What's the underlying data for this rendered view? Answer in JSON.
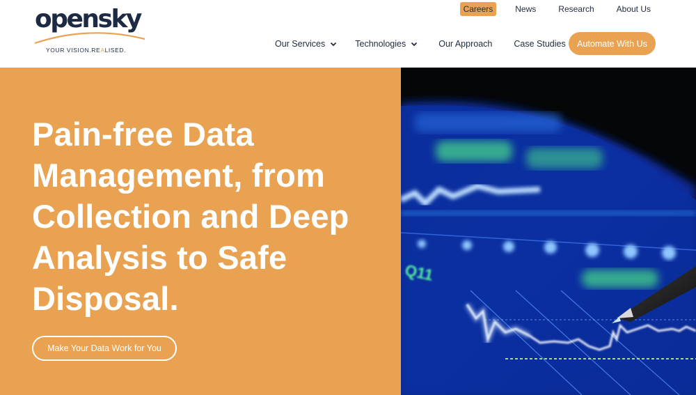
{
  "brand": {
    "name": "opensky",
    "tagline_prefix": "YOUR VISION.RE",
    "tagline_accent": "A",
    "tagline_suffix": "LISED.",
    "colors": {
      "primary_navy": "#1d2a44",
      "accent_orange": "#e8a251"
    }
  },
  "top_nav": [
    {
      "label": "Careers",
      "active": true
    },
    {
      "label": "News",
      "active": false
    },
    {
      "label": "Research",
      "active": false
    },
    {
      "label": "About Us",
      "active": false
    }
  ],
  "main_nav": [
    {
      "label": "Our Services",
      "has_dropdown": true,
      "icon": "chevron-down-icon"
    },
    {
      "label": "Technologies",
      "has_dropdown": true,
      "icon": "chevron-down-icon"
    },
    {
      "label": "Our Approach",
      "has_dropdown": false
    },
    {
      "label": "Case Studies",
      "has_dropdown": false
    }
  ],
  "cta_label": "Automate With Us",
  "hero": {
    "title": "Pain-free Data Management, from Collection and Deep Analysis to Safe Disposal.",
    "button_label": "Make Your Data Work for You",
    "image_description": "Close-up of a stylus pen over a blue glowing financial chart screen"
  }
}
